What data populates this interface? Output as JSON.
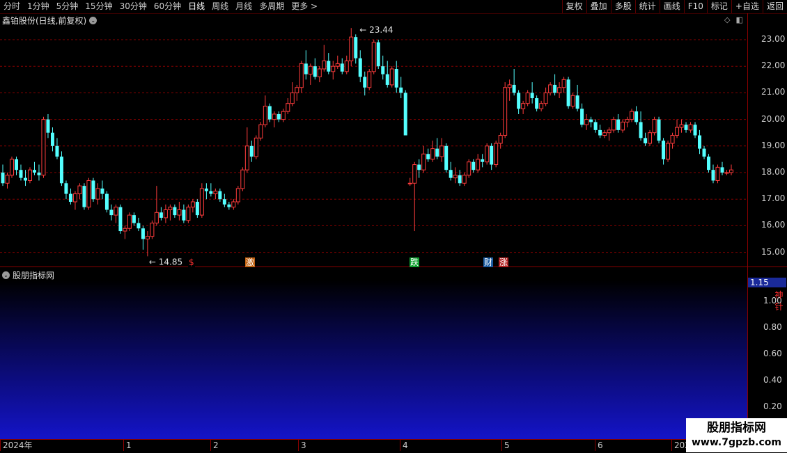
{
  "toolbar": {
    "periods": [
      "分时",
      "1分钟",
      "5分钟",
      "15分钟",
      "30分钟",
      "60分钟",
      "日线",
      "周线",
      "月线",
      "多周期",
      "更多 >"
    ],
    "active_period": "日线",
    "buttons": [
      "复权",
      "叠加",
      "多股",
      "统计",
      "画线",
      "F10",
      "标记",
      "+自选",
      "返回"
    ]
  },
  "chart_title": "鑫铂股份(日线,前复权)",
  "indicator_title": "股朋指标网",
  "price_axis": [
    "23.00",
    "22.00",
    "21.00",
    "20.00",
    "19.00",
    "18.00",
    "17.00",
    "16.00",
    "15.00"
  ],
  "indicator_axis": [
    "1.00",
    "0.80",
    "0.60",
    "0.40",
    "0.20"
  ],
  "indicator_current": "1.15",
  "signal_label": "神针",
  "high_marker": "23.44",
  "low_marker": "14.85",
  "events": [
    {
      "label": "$",
      "color": "#ff3030",
      "bg": "#000"
    },
    {
      "label": "激",
      "color": "#ffffff",
      "bg": "#c06010"
    },
    {
      "label": "跌",
      "color": "#ffffff",
      "bg": "#10a030"
    },
    {
      "label": "财",
      "color": "#ffffff",
      "bg": "#1a5aa0"
    },
    {
      "label": "涨",
      "color": "#ffffff",
      "bg": "#b02020"
    }
  ],
  "date_labels": [
    "2024年",
    "1",
    "2",
    "3",
    "4",
    "5",
    "6",
    "202"
  ],
  "watermark": {
    "title": "股朋指标网",
    "url": "www.7gpzb.com"
  },
  "colors": {
    "up": "#ff3c3c",
    "down": "#54ffff",
    "grid": "#8a0000",
    "signal": "#ff2020"
  },
  "chart_data": {
    "type": "candlestick",
    "ylim": [
      14.7,
      23.6
    ],
    "ohlc": [
      [
        18.0,
        18.3,
        17.5,
        17.6
      ],
      [
        17.6,
        18.0,
        17.4,
        17.9
      ],
      [
        17.9,
        18.6,
        17.8,
        18.5
      ],
      [
        18.5,
        18.6,
        17.9,
        18.1
      ],
      [
        18.1,
        18.3,
        17.7,
        17.8
      ],
      [
        17.8,
        18.1,
        17.5,
        17.7
      ],
      [
        17.7,
        18.2,
        17.6,
        18.1
      ],
      [
        18.1,
        18.4,
        17.9,
        18.0
      ],
      [
        18.0,
        18.3,
        17.7,
        17.9
      ],
      [
        17.9,
        20.1,
        17.8,
        20.0
      ],
      [
        20.0,
        20.2,
        19.3,
        19.5
      ],
      [
        19.5,
        19.7,
        18.8,
        19.0
      ],
      [
        19.0,
        19.3,
        18.5,
        18.6
      ],
      [
        18.6,
        18.8,
        17.5,
        17.6
      ],
      [
        17.6,
        17.7,
        17.0,
        17.2
      ],
      [
        17.2,
        17.4,
        16.8,
        16.9
      ],
      [
        16.9,
        17.3,
        16.6,
        17.2
      ],
      [
        17.2,
        17.6,
        17.0,
        17.5
      ],
      [
        17.5,
        17.6,
        16.6,
        16.7
      ],
      [
        16.7,
        17.8,
        16.6,
        17.7
      ],
      [
        17.7,
        17.8,
        16.9,
        17.0
      ],
      [
        17.0,
        17.6,
        16.8,
        17.4
      ],
      [
        17.4,
        17.7,
        17.0,
        17.2
      ],
      [
        17.2,
        17.3,
        16.5,
        16.6
      ],
      [
        16.6,
        16.8,
        16.2,
        16.4
      ],
      [
        16.4,
        16.8,
        16.1,
        16.7
      ],
      [
        16.7,
        16.8,
        15.7,
        15.8
      ],
      [
        15.8,
        16.0,
        15.5,
        15.9
      ],
      [
        15.9,
        16.5,
        15.8,
        16.4
      ],
      [
        16.4,
        16.5,
        16.0,
        16.1
      ],
      [
        16.1,
        16.3,
        15.8,
        15.9
      ],
      [
        15.9,
        16.0,
        15.1,
        15.5
      ],
      [
        15.5,
        15.8,
        14.85,
        15.6
      ],
      [
        15.6,
        16.2,
        15.5,
        16.1
      ],
      [
        16.1,
        17.5,
        16.0,
        16.5
      ],
      [
        16.5,
        16.7,
        16.2,
        16.3
      ],
      [
        16.3,
        16.8,
        16.1,
        16.6
      ],
      [
        16.6,
        16.8,
        16.2,
        16.7
      ],
      [
        16.7,
        16.8,
        16.3,
        16.4
      ],
      [
        16.4,
        16.9,
        16.2,
        16.6
      ],
      [
        16.6,
        16.8,
        16.1,
        16.2
      ],
      [
        16.2,
        16.8,
        16.1,
        16.7
      ],
      [
        16.7,
        17.0,
        16.5,
        16.9
      ],
      [
        16.9,
        17.0,
        16.3,
        16.4
      ],
      [
        16.4,
        17.6,
        16.3,
        17.4
      ],
      [
        17.4,
        17.6,
        17.0,
        17.3
      ],
      [
        17.3,
        17.6,
        17.1,
        17.2
      ],
      [
        17.2,
        17.4,
        17.0,
        17.3
      ],
      [
        17.3,
        17.4,
        16.9,
        17.0
      ],
      [
        17.0,
        17.2,
        16.7,
        16.8
      ],
      [
        16.8,
        16.9,
        16.6,
        16.7
      ],
      [
        16.7,
        17.0,
        16.6,
        16.9
      ],
      [
        16.9,
        17.5,
        16.8,
        17.4
      ],
      [
        17.4,
        18.2,
        17.3,
        18.1
      ],
      [
        18.1,
        19.7,
        18.0,
        19.0
      ],
      [
        19.0,
        19.2,
        18.4,
        18.6
      ],
      [
        18.6,
        19.4,
        18.5,
        19.3
      ],
      [
        19.3,
        19.9,
        19.2,
        19.8
      ],
      [
        19.8,
        20.9,
        19.7,
        20.5
      ],
      [
        20.5,
        20.6,
        19.9,
        20.0
      ],
      [
        20.0,
        20.3,
        19.7,
        20.2
      ],
      [
        20.2,
        20.3,
        19.9,
        20.0
      ],
      [
        20.0,
        20.4,
        19.9,
        20.3
      ],
      [
        20.3,
        20.8,
        20.2,
        20.6
      ],
      [
        20.6,
        21.4,
        20.5,
        21.0
      ],
      [
        21.0,
        21.3,
        20.7,
        21.2
      ],
      [
        21.2,
        22.2,
        21.0,
        22.1
      ],
      [
        22.1,
        22.6,
        21.5,
        21.7
      ],
      [
        21.7,
        22.1,
        21.3,
        22.0
      ],
      [
        22.0,
        22.3,
        21.5,
        21.6
      ],
      [
        21.6,
        22.0,
        21.4,
        21.9
      ],
      [
        21.9,
        22.8,
        21.8,
        22.2
      ],
      [
        22.2,
        22.5,
        21.7,
        21.8
      ],
      [
        21.8,
        22.2,
        21.5,
        22.0
      ],
      [
        22.0,
        22.4,
        21.9,
        22.1
      ],
      [
        22.1,
        22.3,
        21.7,
        21.8
      ],
      [
        21.8,
        22.4,
        21.7,
        22.2
      ],
      [
        22.2,
        23.44,
        22.0,
        23.1
      ],
      [
        23.1,
        23.2,
        22.1,
        22.3
      ],
      [
        22.3,
        22.6,
        21.4,
        21.6
      ],
      [
        21.6,
        21.8,
        20.9,
        21.2
      ],
      [
        21.2,
        21.9,
        21.1,
        21.8
      ],
      [
        21.8,
        23.0,
        21.7,
        22.9
      ],
      [
        22.9,
        23.0,
        21.9,
        22.0
      ],
      [
        22.0,
        22.4,
        21.5,
        21.7
      ],
      [
        21.7,
        22.2,
        21.2,
        21.3
      ],
      [
        21.3,
        22.0,
        21.2,
        21.9
      ],
      [
        21.9,
        22.2,
        21.0,
        21.2
      ],
      [
        21.2,
        21.6,
        20.8,
        21.0
      ],
      [
        21.0,
        21.1,
        19.5,
        19.4
      ],
      [
        17.6,
        17.8,
        17.5,
        17.6
      ],
      [
        17.6,
        18.4,
        15.8,
        18.3
      ],
      [
        18.3,
        18.5,
        17.8,
        18.1
      ],
      [
        18.1,
        19.0,
        18.0,
        18.7
      ],
      [
        18.7,
        18.9,
        18.4,
        18.5
      ],
      [
        18.5,
        19.2,
        18.4,
        18.9
      ],
      [
        18.9,
        19.3,
        18.5,
        18.6
      ],
      [
        18.6,
        19.3,
        18.4,
        19.0
      ],
      [
        19.0,
        19.1,
        18.0,
        18.1
      ],
      [
        18.1,
        18.4,
        17.7,
        17.8
      ],
      [
        17.8,
        18.2,
        17.6,
        17.9
      ],
      [
        17.9,
        18.1,
        17.5,
        17.6
      ],
      [
        17.6,
        18.0,
        17.5,
        17.9
      ],
      [
        17.9,
        18.5,
        17.8,
        18.4
      ],
      [
        18.4,
        18.5,
        18.0,
        18.1
      ],
      [
        18.1,
        18.7,
        18.0,
        18.5
      ],
      [
        18.5,
        18.7,
        18.2,
        18.4
      ],
      [
        18.4,
        19.1,
        18.3,
        19.0
      ],
      [
        19.0,
        19.1,
        18.1,
        18.3
      ],
      [
        18.3,
        19.2,
        18.2,
        19.1
      ],
      [
        19.1,
        19.5,
        18.9,
        19.4
      ],
      [
        19.4,
        21.4,
        19.3,
        21.2
      ],
      [
        21.2,
        21.5,
        20.7,
        21.3
      ],
      [
        21.3,
        21.9,
        20.9,
        21.0
      ],
      [
        21.0,
        21.1,
        20.2,
        20.4
      ],
      [
        20.4,
        20.7,
        20.2,
        20.6
      ],
      [
        20.6,
        21.1,
        20.5,
        21.0
      ],
      [
        21.0,
        21.4,
        20.6,
        20.8
      ],
      [
        20.8,
        20.9,
        20.3,
        20.4
      ],
      [
        20.4,
        20.7,
        20.3,
        20.6
      ],
      [
        20.6,
        21.2,
        20.5,
        21.0
      ],
      [
        21.0,
        21.4,
        20.9,
        21.3
      ],
      [
        21.3,
        21.7,
        20.9,
        21.0
      ],
      [
        21.0,
        21.4,
        20.8,
        21.2
      ],
      [
        21.2,
        21.6,
        21.0,
        21.5
      ],
      [
        21.5,
        21.6,
        20.4,
        20.5
      ],
      [
        20.5,
        21.0,
        20.4,
        20.9
      ],
      [
        20.9,
        21.3,
        20.3,
        20.4
      ],
      [
        20.4,
        20.6,
        19.7,
        19.8
      ],
      [
        19.8,
        20.2,
        19.6,
        20.0
      ],
      [
        20.0,
        20.1,
        19.7,
        19.9
      ],
      [
        19.9,
        20.0,
        19.5,
        19.6
      ],
      [
        19.6,
        19.8,
        19.3,
        19.4
      ],
      [
        19.4,
        19.6,
        19.3,
        19.5
      ],
      [
        19.5,
        19.7,
        19.2,
        19.6
      ],
      [
        19.6,
        20.1,
        19.5,
        20.0
      ],
      [
        20.0,
        20.2,
        19.5,
        19.6
      ],
      [
        19.6,
        20.0,
        19.5,
        19.9
      ],
      [
        19.9,
        20.1,
        19.7,
        20.0
      ],
      [
        20.0,
        20.4,
        19.9,
        20.3
      ],
      [
        20.3,
        20.5,
        19.8,
        19.9
      ],
      [
        19.9,
        20.3,
        19.2,
        19.3
      ],
      [
        19.3,
        19.5,
        19.0,
        19.1
      ],
      [
        19.1,
        19.6,
        19.0,
        19.5
      ],
      [
        19.5,
        20.1,
        19.4,
        20.0
      ],
      [
        20.0,
        20.1,
        19.1,
        19.2
      ],
      [
        19.2,
        19.3,
        18.3,
        18.5
      ],
      [
        18.5,
        19.2,
        18.4,
        19.1
      ],
      [
        19.1,
        19.5,
        18.9,
        19.4
      ],
      [
        19.4,
        20.0,
        19.3,
        19.7
      ],
      [
        19.7,
        20.0,
        19.5,
        19.8
      ],
      [
        19.8,
        19.9,
        19.5,
        19.6
      ],
      [
        19.6,
        19.9,
        19.5,
        19.8
      ],
      [
        19.8,
        19.9,
        19.3,
        19.4
      ],
      [
        19.4,
        19.6,
        18.7,
        18.9
      ],
      [
        18.9,
        19.0,
        18.5,
        18.6
      ],
      [
        18.6,
        18.7,
        18.0,
        18.1
      ],
      [
        18.1,
        18.3,
        17.6,
        17.7
      ],
      [
        17.7,
        18.3,
        17.6,
        18.2
      ],
      [
        18.2,
        18.4,
        17.9,
        18.0
      ],
      [
        18.0,
        18.1,
        17.9,
        18.0
      ],
      [
        18.0,
        18.3,
        17.9,
        18.1
      ]
    ],
    "indicator": {
      "name": "神针",
      "ylim": [
        0,
        1.15
      ],
      "signal_index": 172,
      "value": 1.0
    }
  }
}
